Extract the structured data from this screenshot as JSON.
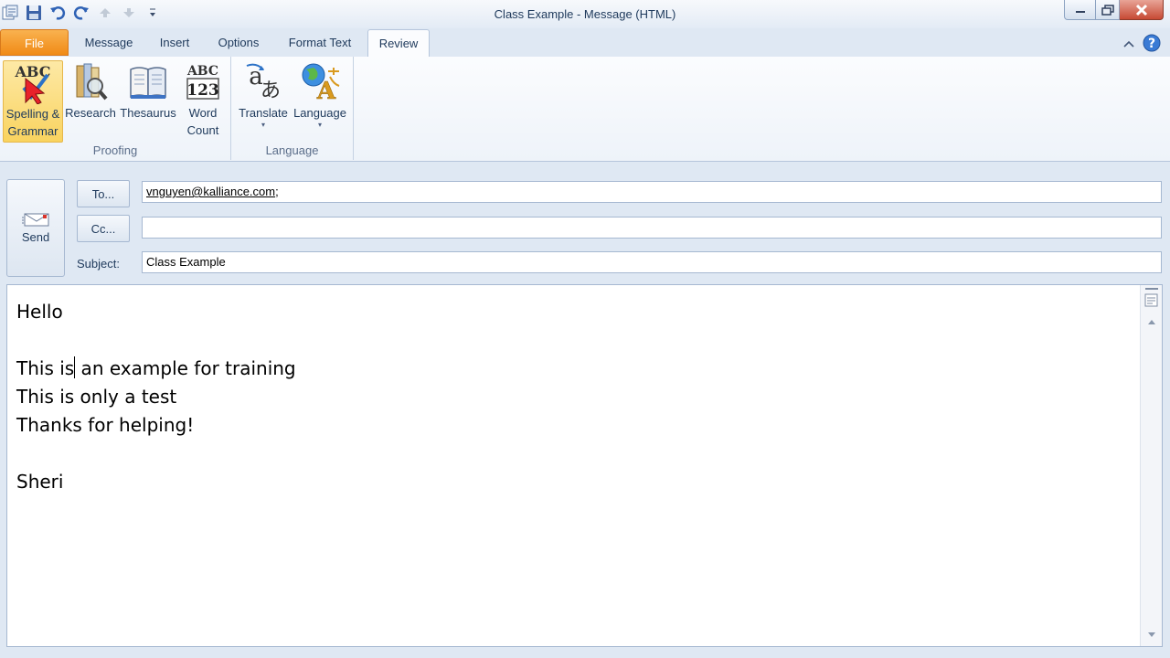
{
  "window": {
    "title": "Class Example  -  Message (HTML)"
  },
  "tabs": [
    {
      "label": "File"
    },
    {
      "label": "Message"
    },
    {
      "label": "Insert"
    },
    {
      "label": "Options"
    },
    {
      "label": "Format Text"
    },
    {
      "label": "Review"
    }
  ],
  "active_tab": "Review",
  "ribbon": {
    "proofing": {
      "label": "Proofing",
      "spelling_line1": "Spelling &",
      "spelling_line2": "Grammar",
      "research": "Research",
      "thesaurus": "Thesaurus",
      "wordcount_line1": "Word",
      "wordcount_line2": "Count"
    },
    "language": {
      "label": "Language",
      "translate": "Translate",
      "language": "Language",
      "dropdown_glyph": "▾"
    }
  },
  "compose": {
    "send_label": "Send",
    "to_button": "To...",
    "cc_button": "Cc...",
    "subject_label": "Subject:",
    "to_recipient": "vnguyen@kalliance.com",
    "to_separator": ";",
    "cc_value": "",
    "subject_value": "Class Example"
  },
  "body": {
    "line1": "Hello",
    "line2": "",
    "line3_before_caret": "This is",
    "line3_after_caret": " an example for training",
    "line4": "This is only a test",
    "line5": "Thanks for helping!",
    "line6": "",
    "line7": "Sheri"
  },
  "colors": {
    "file_tab": "#f08a16",
    "ribbon_bg": "#fbfcfe",
    "frame_bg": "#dfe8f3",
    "pressed_button": "#f9d35f",
    "close_button": "#c74a34"
  }
}
